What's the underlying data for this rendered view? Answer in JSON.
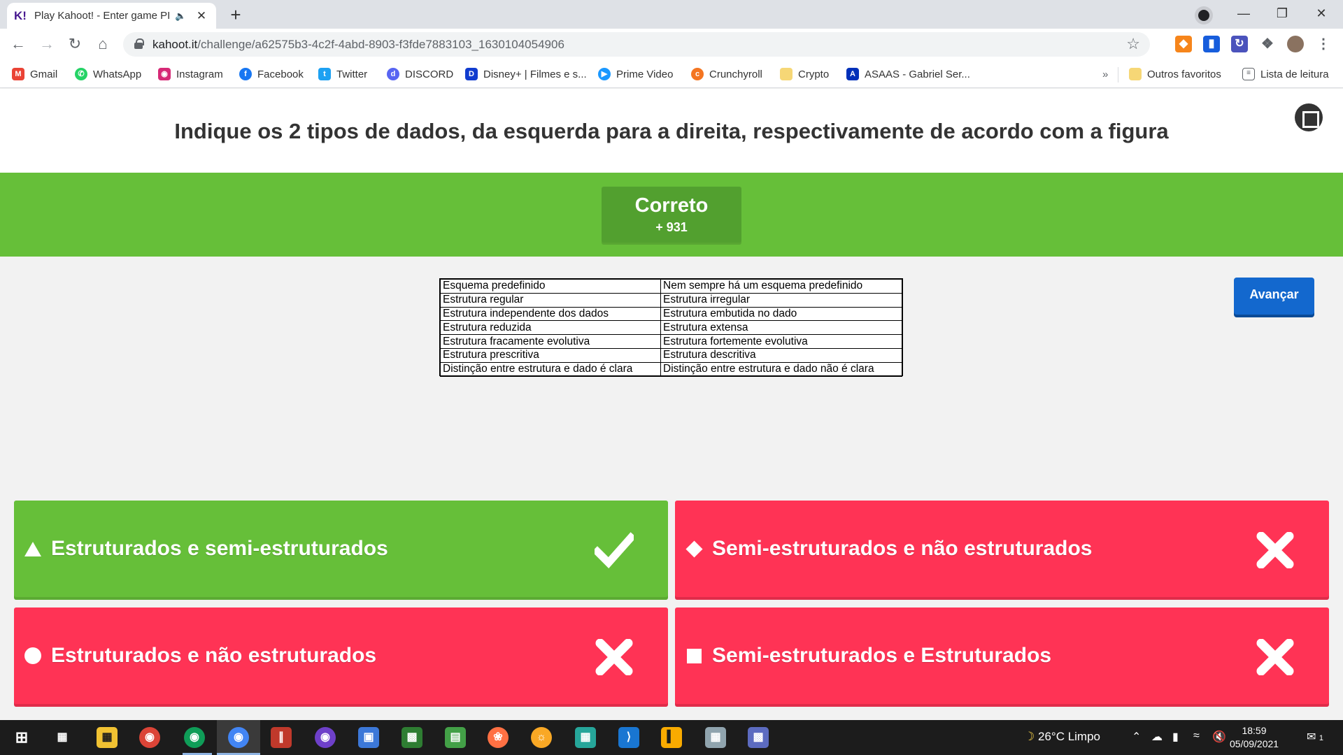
{
  "browser": {
    "tab_title": "Play Kahoot! - Enter game PIN",
    "tab_favicon": "K!",
    "url_host": "kahoot.it",
    "url_path": "/challenge/a62575b3-4c2f-4abd-8903-f3fde7883103_1630104054906"
  },
  "bookmarks": [
    {
      "label": "Gmail",
      "icon": "gmail-icon",
      "color": "#ea4335"
    },
    {
      "label": "WhatsApp",
      "icon": "whatsapp-icon",
      "color": "#25d366"
    },
    {
      "label": "Instagram",
      "icon": "instagram-icon",
      "color": "#d62976"
    },
    {
      "label": "Facebook",
      "icon": "facebook-icon",
      "color": "#1877f2"
    },
    {
      "label": "Twitter",
      "icon": "twitter-icon",
      "color": "#1da1f2"
    },
    {
      "label": "DISCORD",
      "icon": "discord-icon",
      "color": "#5865f2"
    },
    {
      "label": "Disney+ | Filmes e s...",
      "icon": "disney-icon",
      "color": "#113ccf"
    },
    {
      "label": "Prime Video",
      "icon": "prime-video-icon",
      "color": "#1a98ff"
    },
    {
      "label": "Crunchyroll",
      "icon": "crunchyroll-icon",
      "color": "#f47521"
    },
    {
      "label": "Crypto",
      "icon": "folder-icon",
      "color": "#f6d776"
    },
    {
      "label": "ASAAS - Gabriel Ser...",
      "icon": "asaas-icon",
      "color": "#0030b9"
    }
  ],
  "bookmarks_more": "»",
  "other_favorites": "Outros favoritos",
  "reading_list": "Lista de leitura",
  "question": "Indique os 2 tipos de dados, da esquerda para a direita, respectivamente de acordo com a figura",
  "result": {
    "title": "Correto",
    "points": "+ 931"
  },
  "next_label": "Avançar",
  "figure_rows": [
    [
      "Esquema predefinido",
      "Nem sempre há um esquema predefinido"
    ],
    [
      "Estrutura regular",
      "Estrutura irregular"
    ],
    [
      "Estrutura independente dos dados",
      "Estrutura embutida no dado"
    ],
    [
      "Estrutura reduzida",
      "Estrutura extensa"
    ],
    [
      "Estrutura fracamente evolutiva",
      "Estrutura fortemente evolutiva"
    ],
    [
      "Estrutura prescritiva",
      "Estrutura descritiva"
    ],
    [
      "Distinção entre estrutura e dado é clara",
      "Distinção entre estrutura e dado não é clara"
    ]
  ],
  "answers": [
    {
      "text": "Estruturados e semi-estruturados",
      "shape": "triangle",
      "correct": true
    },
    {
      "text": "Semi-estruturados e não estruturados",
      "shape": "diamond",
      "correct": false
    },
    {
      "text": "Estruturados e não estruturados",
      "shape": "circle",
      "correct": false
    },
    {
      "text": "Semi-estruturados e Estruturados",
      "shape": "square",
      "correct": false
    }
  ],
  "colors": {
    "correct": "#66bf39",
    "wrong": "#ff3355",
    "next_button": "#1368ce"
  },
  "taskbar": {
    "weather": "26°C  Limpo",
    "time": "18:59",
    "date": "05/09/2021",
    "notification_count": "1"
  }
}
